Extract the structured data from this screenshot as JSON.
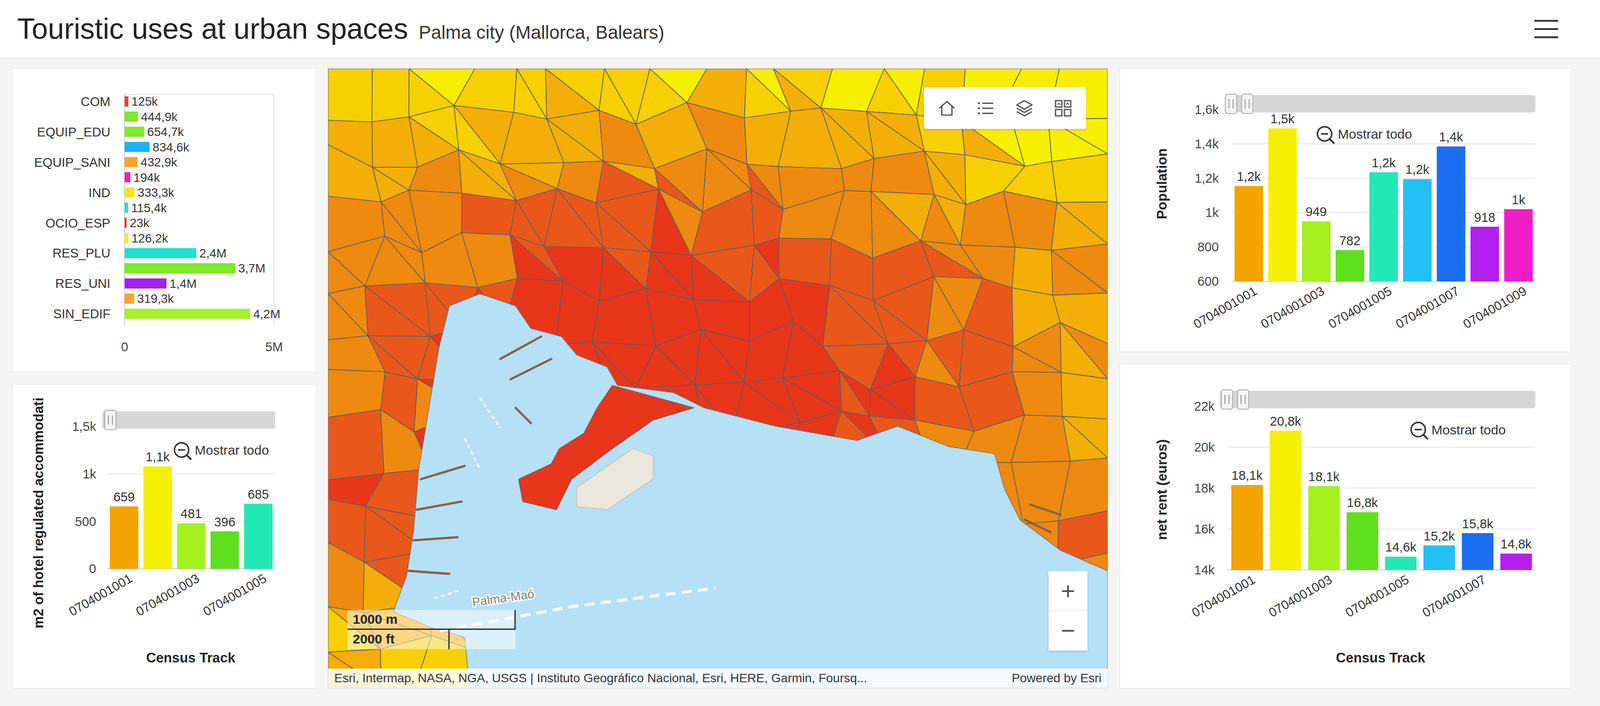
{
  "header": {
    "title": "Touristic uses at urban spaces",
    "subtitle": "Palma city (Mallorca, Balears)"
  },
  "land_use_chart": {
    "ticks": [
      {
        "label": "0",
        "value": 0
      },
      {
        "label": "5M",
        "value": 5000000
      }
    ],
    "bars": [
      {
        "category": "COM",
        "value": 125000,
        "label": "125k",
        "color": "#e8402a"
      },
      {
        "value": 444900,
        "label": "444,9k",
        "color": "#7ee82a"
      },
      {
        "category": "EQUIP_EDU",
        "value": 654700,
        "label": "654,7k",
        "color": "#7ee82a"
      },
      {
        "value": 834600,
        "label": "834,6k",
        "color": "#19b4f5"
      },
      {
        "category": "EQUIP_SANI",
        "value": 432900,
        "label": "432,9k",
        "color": "#f5a623"
      },
      {
        "value": 194000,
        "label": "194k",
        "color": "#e821c0"
      },
      {
        "category": "IND",
        "value": 333300,
        "label": "333,3k",
        "color": "#f5e61e"
      },
      {
        "value": 115400,
        "label": "115,4k",
        "color": "#22e0d0"
      },
      {
        "category": "OCIO_ESP",
        "value": 23000,
        "label": "23k",
        "color": "#e8402a"
      },
      {
        "value": 126200,
        "label": "126,2k",
        "color": "#f5e61e"
      },
      {
        "category": "RES_PLU",
        "value": 2400000,
        "label": "2,4M",
        "color": "#22e0d0"
      },
      {
        "value": 3700000,
        "label": "3,7M",
        "color": "#7ee82a"
      },
      {
        "category": "RES_UNI",
        "value": 1400000,
        "label": "1,4M",
        "color": "#a41ef0"
      },
      {
        "value": 319300,
        "label": "319,3k",
        "color": "#f5a623"
      },
      {
        "category": "SIN_EDIF",
        "value": 4200000,
        "label": "4,2M",
        "color": "#a8f02a"
      }
    ]
  },
  "hotel_chart": {
    "axis_title": "m2 of hotel regulated accommodati",
    "x_title": "Census Track",
    "button": "Mostrar todo",
    "scrollbar": {
      "start": 0.047,
      "end": 0.047
    },
    "ticks": [
      {
        "label": "0",
        "value": 0
      },
      {
        "label": "500",
        "value": 500
      },
      {
        "label": "1k",
        "value": 1000
      },
      {
        "label": "1,5k",
        "value": 1500
      }
    ],
    "bars": [
      {
        "category": "0704001001",
        "value": 659,
        "label": "659",
        "color": "#f5a300"
      },
      {
        "value": 1080,
        "label": "1,1k",
        "color": "#f5f000"
      },
      {
        "category": "0704001003",
        "value": 481,
        "label": "481",
        "color": "#a6f01e"
      },
      {
        "value": 396,
        "label": "396",
        "color": "#5ee01e"
      },
      {
        "category": "0704001005",
        "value": 685,
        "label": "685",
        "color": "#22e8b4"
      }
    ]
  },
  "population_chart": {
    "axis_title": "Population",
    "button": "Mostrar todo",
    "scrollbar": {
      "start": 0.02,
      "end": 0.072
    },
    "ticks": [
      {
        "label": "600",
        "value": 600
      },
      {
        "label": "800",
        "value": 800
      },
      {
        "label": "1k",
        "value": 1000
      },
      {
        "label": "1,2k",
        "value": 1200
      },
      {
        "label": "1,4k",
        "value": 1400
      },
      {
        "label": "1,6k",
        "value": 1600
      }
    ],
    "bars": [
      {
        "category": "0704001001",
        "value": 1155,
        "label": "1,2k",
        "color": "#f5a300"
      },
      {
        "value": 1490,
        "label": "1,5k",
        "color": "#f5f000"
      },
      {
        "category": "0704001003",
        "value": 949,
        "label": "949",
        "color": "#a6f01e"
      },
      {
        "value": 782,
        "label": "782",
        "color": "#5ee01e"
      },
      {
        "category": "0704001005",
        "value": 1235,
        "label": "1,2k",
        "color": "#22e8b4"
      },
      {
        "value": 1195,
        "label": "1,2k",
        "color": "#22c0f5"
      },
      {
        "category": "0704001007",
        "value": 1385,
        "label": "1,4k",
        "color": "#1c6ef0"
      },
      {
        "value": 918,
        "label": "918",
        "color": "#b41ef0"
      },
      {
        "category": "0704001009",
        "value": 1020,
        "label": "1k",
        "color": "#f01ec8"
      }
    ]
  },
  "rent_chart": {
    "axis_title": "net rent (euros)",
    "x_title": "Census Track",
    "button": "Mostrar todo",
    "scrollbar": {
      "start": 0.023,
      "end": 0.074
    },
    "ticks": [
      {
        "label": "14k",
        "value": 14000
      },
      {
        "label": "16k",
        "value": 16000
      },
      {
        "label": "18k",
        "value": 18000
      },
      {
        "label": "20k",
        "value": 20000
      },
      {
        "label": "22k",
        "value": 22000
      }
    ],
    "bars": [
      {
        "category": "0704001001",
        "value": 18150,
        "label": "18,1k",
        "color": "#f5a300"
      },
      {
        "value": 20800,
        "label": "20,8k",
        "color": "#f5f000"
      },
      {
        "category": "0704001003",
        "value": 18100,
        "label": "18,1k",
        "color": "#a6f01e"
      },
      {
        "value": 16820,
        "label": "16,8k",
        "color": "#5ee01e"
      },
      {
        "category": "0704001005",
        "value": 14650,
        "label": "14,6k",
        "color": "#22e8b4"
      },
      {
        "value": 15200,
        "label": "15,2k",
        "color": "#22c0f5"
      },
      {
        "category": "0704001007",
        "value": 15800,
        "label": "15,8k",
        "color": "#1c6ef0"
      },
      {
        "value": 14800,
        "label": "14,8k",
        "color": "#b41ef0"
      }
    ]
  },
  "map": {
    "scale": {
      "metric": "1000 m",
      "imperial": "2000 ft"
    },
    "attribution": "Esri, Intermap, NASA, NGA, USGS | Instituto Geográfico Nacional, Esri, HERE, Garmin, Foursq...",
    "powered_by": "Powered by Esri",
    "route_label": "Palma-Maó",
    "zoom_in": "+",
    "zoom_out": "−"
  }
}
